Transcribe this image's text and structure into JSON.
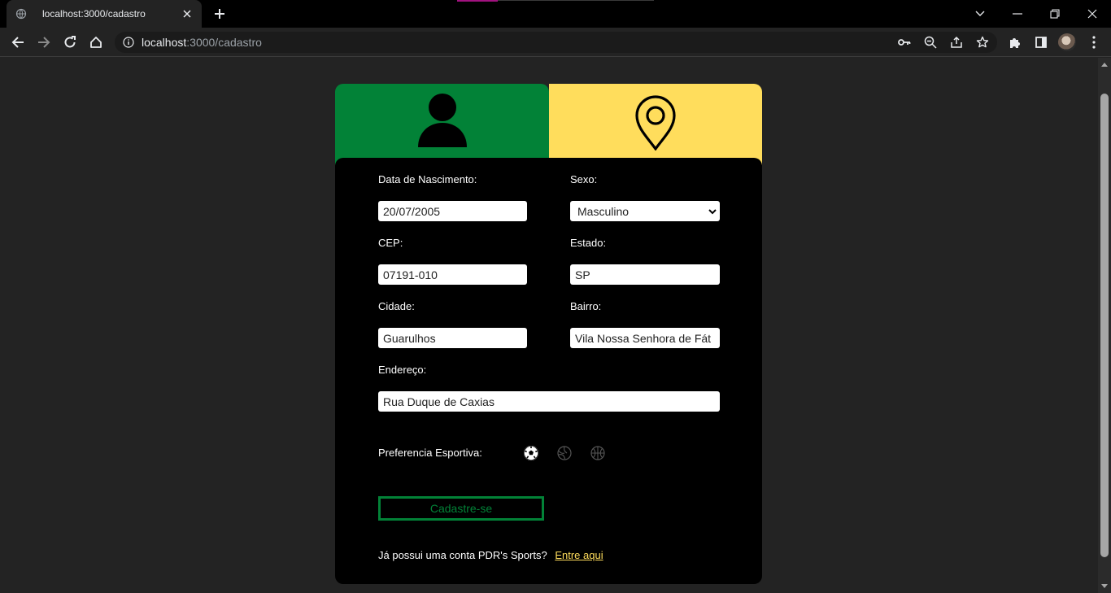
{
  "browser": {
    "tab_title": "localhost:3000/cadastro",
    "url_host": "localhost",
    "url_path": ":3000/cadastro"
  },
  "form": {
    "birth_label": "Data de Nascimento:",
    "birth_value": "20/07/2005",
    "sex_label": "Sexo:",
    "sex_value": "Masculino",
    "cep_label": "CEP:",
    "cep_value": "07191-010",
    "state_label": "Estado:",
    "state_value": "SP",
    "city_label": "Cidade:",
    "city_value": "Guarulhos",
    "district_label": "Bairro:",
    "district_value": "Vila Nossa Senhora de Fát",
    "address_label": "Endereço:",
    "address_value": "Rua Duque de Caxias",
    "sport_label": "Preferencia Esportiva:",
    "sports": [
      "soccer-ball-icon",
      "volleyball-icon",
      "basketball-icon"
    ],
    "submit_label": "Cadastre-se",
    "login_prompt": "Já possui uma conta PDR's Sports?",
    "login_link": "Entre aqui"
  },
  "colors": {
    "green": "#028237",
    "yellow": "#ffdd5c",
    "card": "#000000",
    "background": "#232323"
  }
}
